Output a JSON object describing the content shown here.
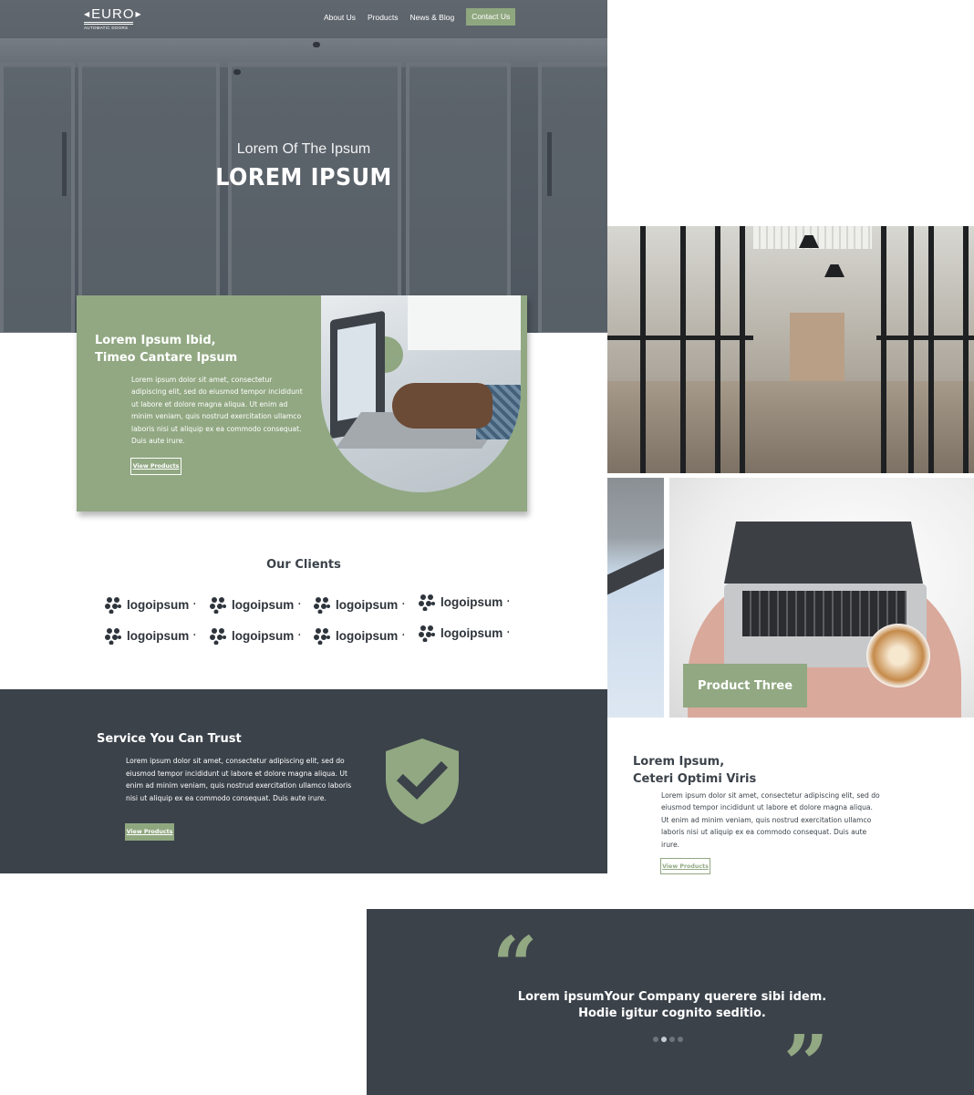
{
  "brand": {
    "logo_word": "EURO",
    "logo_tagline": "AUTOMATIC DOORS"
  },
  "nav": {
    "items": [
      {
        "label": "About Us"
      },
      {
        "label": "Products"
      },
      {
        "label": "News & Blog"
      }
    ],
    "cta_label": "Contact Us",
    "accent": "#8fa77f"
  },
  "hero": {
    "subtitle": "Lorem Of The Ipsum",
    "title": "LOREM IPSUM"
  },
  "feature": {
    "heading_line1": "Lorem Ipsum Ibid,",
    "heading_line2": "Timeo Cantare Ipsum",
    "body": "Lorem ipsum dolor sit amet, consectetur adipiscing elit, sed do eiusmod tempor incididunt ut labore et dolore magna aliqua. Ut enim ad minim veniam, quis nostrud exercitation ullamco laboris nisi ut aliquip ex ea commodo consequat. Duis aute irure.",
    "button_label": "View Products"
  },
  "clients": {
    "title": "Our Clients",
    "logos": [
      "logoipsum",
      "logoipsum",
      "logoipsum",
      "logoipsum",
      "logoipsum",
      "logoipsum",
      "logoipsum",
      "logoipsum"
    ],
    "logo_icon": "flower-mark-icon"
  },
  "trust": {
    "heading": "Service You Can Trust",
    "body": "Lorem ipsum dolor sit amet, consectetur adipiscing elit, sed do eiusmod tempor incididunt ut labore et dolore magna aliqua. Ut enim ad minim veniam, quis nostrud exercitation ullamco laboris nisi ut aliquip ex ea commodo consequat. Duis aute irure.",
    "button_label": "View Products",
    "icon": "shield-check-icon",
    "background": "#3b424a"
  },
  "product": {
    "label": "Product Three"
  },
  "about": {
    "heading_line1": "Lorem Ipsum,",
    "heading_line2": "Ceteri Optimi Viris",
    "body": "Lorem ipsum dolor sit amet, consectetur adipiscing elit, sed do eiusmod tempor incididunt ut labore et dolore magna aliqua. Ut enim ad minim veniam, quis nostrud exercitation ullamco laboris nisi ut aliquip ex ea commodo consequat. Duis aute irure.",
    "button_label": "View Products"
  },
  "testimonial": {
    "quote": "Lorem ipsumYour Company querere sibi idem. Hodie igitur cognito seditio.",
    "open_quote": "“",
    "close_quote": "”",
    "slides": 4,
    "active_slide": 2
  }
}
